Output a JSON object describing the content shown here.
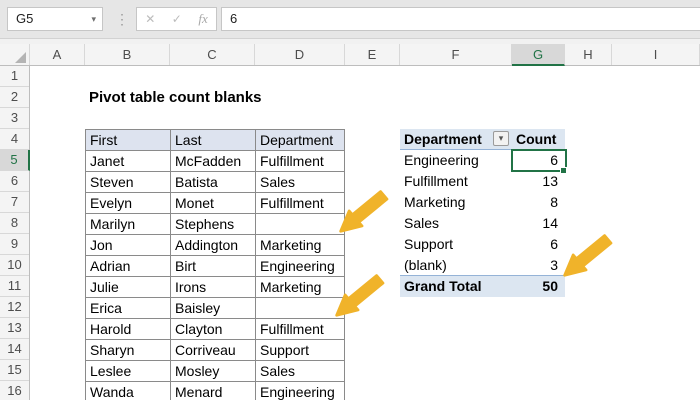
{
  "formula_bar": {
    "name_box": "G5",
    "formula_value": "6",
    "icons": {
      "name_dropdown": "▾",
      "divider": "⋮",
      "cancel": "✕",
      "confirm": "✓",
      "fx": "fx"
    }
  },
  "grid": {
    "column_letters": [
      "A",
      "B",
      "C",
      "D",
      "E",
      "F",
      "G",
      "H",
      "I"
    ],
    "row_numbers": [
      "1",
      "2",
      "3",
      "4",
      "5",
      "6",
      "7",
      "8",
      "9",
      "10",
      "11",
      "12",
      "13",
      "14",
      "15",
      "16"
    ],
    "selected_cell": "G5",
    "selected_column": "G",
    "selected_row": "5"
  },
  "sheet": {
    "title": "Pivot table count blanks"
  },
  "data_table": {
    "headers": [
      "First",
      "Last",
      "Department"
    ],
    "rows": [
      [
        "Janet",
        "McFadden",
        "Fulfillment"
      ],
      [
        "Steven",
        "Batista",
        "Sales"
      ],
      [
        "Evelyn",
        "Monet",
        "Fulfillment"
      ],
      [
        "Marilyn",
        "Stephens",
        ""
      ],
      [
        "Jon",
        "Addington",
        "Marketing"
      ],
      [
        "Adrian",
        "Birt",
        "Engineering"
      ],
      [
        "Julie",
        "Irons",
        "Marketing"
      ],
      [
        "Erica",
        "Baisley",
        ""
      ],
      [
        "Harold",
        "Clayton",
        "Fulfillment"
      ],
      [
        "Sharyn",
        "Corriveau",
        "Support"
      ],
      [
        "Leslee",
        "Mosley",
        "Sales"
      ],
      [
        "Wanda",
        "Menard",
        "Engineering"
      ]
    ]
  },
  "pivot_table": {
    "header": {
      "department": "Department",
      "count": "Count"
    },
    "rows": [
      {
        "dept": "Engineering",
        "count": "6"
      },
      {
        "dept": "Fulfillment",
        "count": "13"
      },
      {
        "dept": "Marketing",
        "count": "8"
      },
      {
        "dept": "Sales",
        "count": "14"
      },
      {
        "dept": "Support",
        "count": "6"
      },
      {
        "dept": "(blank)",
        "count": "3"
      }
    ],
    "grand_total": {
      "label": "Grand Total",
      "value": "50"
    }
  },
  "colors": {
    "excel_green": "#217346",
    "arrow_gold": "#F0B32A",
    "pivot_fill": "#DCE6F1",
    "pivot_border": "#95B3D7",
    "data_header_fill": "#DDE3EF",
    "table_border": "#8A8A8A",
    "topbar_bg": "#E6E6E6"
  }
}
